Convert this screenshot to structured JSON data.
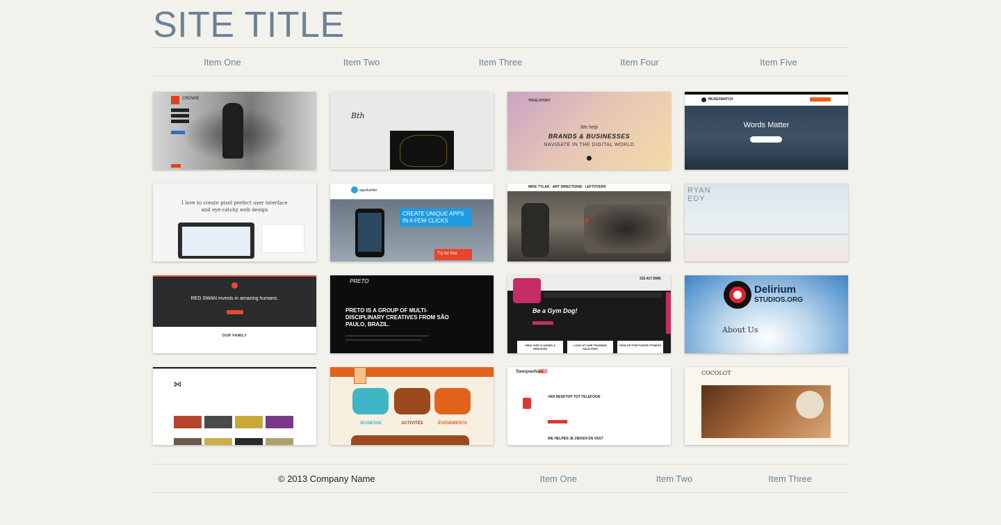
{
  "header": {
    "title": "SITE TITLE"
  },
  "nav": [
    "Item One",
    "Item Two",
    "Item Three",
    "Item Four",
    "Item Five"
  ],
  "thumbs": {
    "crowie": {
      "brand": "CROWIE"
    },
    "craft": {
      "logo": "Bth"
    },
    "truestory": {
      "logo": "TRUE STORY",
      "line1": "We help",
      "line2": "BRANDS & BUSINESSES",
      "line3": "NAVIGATE IN THE DIGITAL WORLD"
    },
    "muse": {
      "brand": "MUSEXMATCH",
      "headline": "Words Matter"
    },
    "pixel": {
      "line1": "I love to create pixel perfect user interface",
      "line2": "and eye-catchy web design"
    },
    "apps": {
      "brand": "appsbuilder",
      "line1": "CREATE UNIQUE APPS",
      "line2": "IN A FEW CLICKS",
      "cta": "Try for free"
    },
    "mike": {
      "title": "MIKE TYLAK · ART DIRECTIONS · LEFTOVERS"
    },
    "ryan": {
      "line1": "RYAN",
      "line2": "EDY"
    },
    "redswan": {
      "text": "RED SWAN invests in amazing humans.",
      "section": "OUR FAMILY"
    },
    "preto": {
      "logo": "PRETO",
      "headline": "PRETO IS A GROUP OF MULTI-DISCIPLINARY CREATIVES FROM SÃO PAULO, BRAZIL."
    },
    "gym": {
      "phone": "315.417.9996",
      "tagline": "Be a Gym Dog!",
      "box1": "VIEW OUR CLASSES & SERVICES",
      "box2": "LOOK AT OUR TRAINING FACILITIES",
      "box3": "SIGN UP FOR POINTE FITNESS"
    },
    "delirium": {
      "name": "Delirium",
      "sub": "STUDIOS.ORG",
      "about": "About Us"
    },
    "okaka": {
      "logo": "⋈"
    },
    "jeunesse": {
      "tab1": "JEUNESSE",
      "tab2": "ACTIVITÉS",
      "tab3": "ÉVÉNEMENTS"
    },
    "tonny": {
      "brand": "Tonnyverhoef",
      "num": "360",
      "head1": "VAN DESKTOP TOT TELEFOON",
      "head2": "WE HELPEN JE ZIEKEN EN VAST"
    },
    "cocolot": {
      "brand": "COCOLOT"
    }
  },
  "footer": {
    "copyright": "© 2013 Company Name",
    "links": [
      "Item One",
      "Item Two",
      "Item Three"
    ]
  }
}
